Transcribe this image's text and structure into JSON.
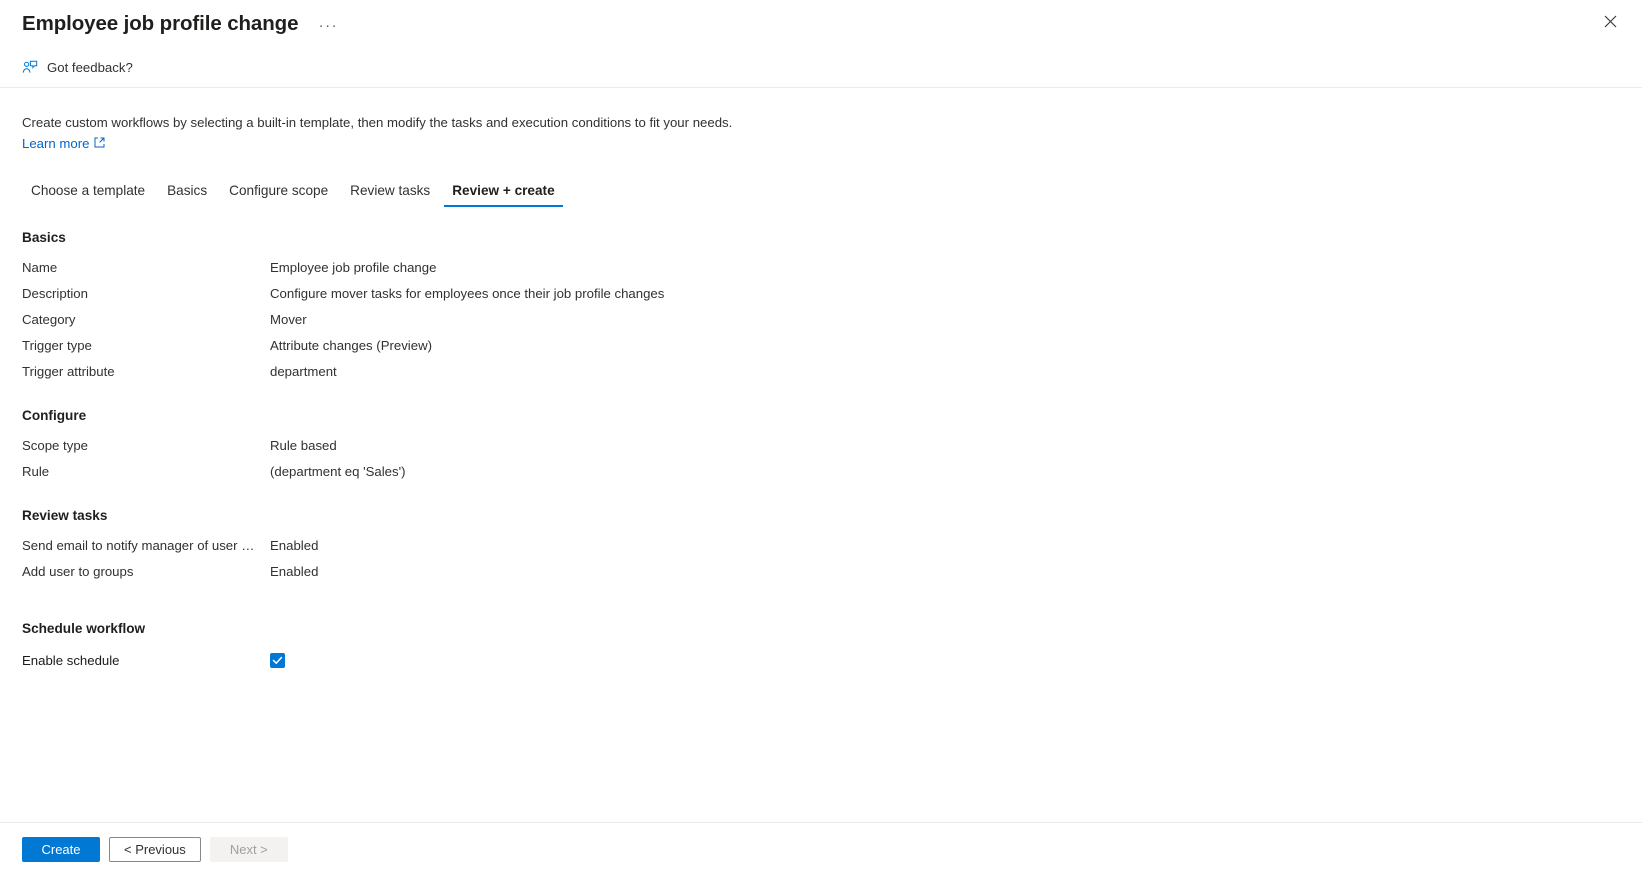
{
  "header": {
    "title": "Employee job profile change",
    "more_label": "···",
    "close_label": "",
    "feedback_label": "Got feedback?"
  },
  "intro": {
    "description": "Create custom workflows by selecting a built-in template, then modify the tasks and execution conditions to fit your needs.",
    "learn_more_label": "Learn more"
  },
  "tabs": [
    {
      "label": "Choose a template",
      "selected": false
    },
    {
      "label": "Basics",
      "selected": false
    },
    {
      "label": "Configure scope",
      "selected": false
    },
    {
      "label": "Review tasks",
      "selected": false
    },
    {
      "label": "Review + create",
      "selected": true
    }
  ],
  "sections": {
    "basics": {
      "title": "Basics",
      "rows": [
        {
          "key": "Name",
          "value": "Employee job profile change"
        },
        {
          "key": "Description",
          "value": "Configure mover tasks for employees once their job profile changes"
        },
        {
          "key": "Category",
          "value": "Mover"
        },
        {
          "key": "Trigger type",
          "value": "Attribute changes (Preview)"
        },
        {
          "key": "Trigger attribute",
          "value": "department"
        }
      ]
    },
    "configure": {
      "title": "Configure",
      "rows": [
        {
          "key": "Scope type",
          "value": "Rule based"
        },
        {
          "key": "Rule",
          "value": "(department eq 'Sales')"
        }
      ]
    },
    "review_tasks": {
      "title": "Review tasks",
      "rows": [
        {
          "key": "Send email to notify manager of user mo…",
          "value": "Enabled"
        },
        {
          "key": "Add user to groups",
          "value": "Enabled"
        }
      ]
    },
    "schedule": {
      "title": "Schedule workflow",
      "enable_label": "Enable schedule",
      "enable_checked": true
    }
  },
  "footer": {
    "create_label": "Create",
    "previous_label": "< Previous",
    "next_label": "Next >"
  },
  "colors": {
    "accent": "#0078d4",
    "link": "#0066cc",
    "text": "#323130",
    "heading": "#201f1e",
    "divider": "#edebe9",
    "disabled_bg": "#f3f2f1",
    "disabled_text": "#a19f9d"
  }
}
